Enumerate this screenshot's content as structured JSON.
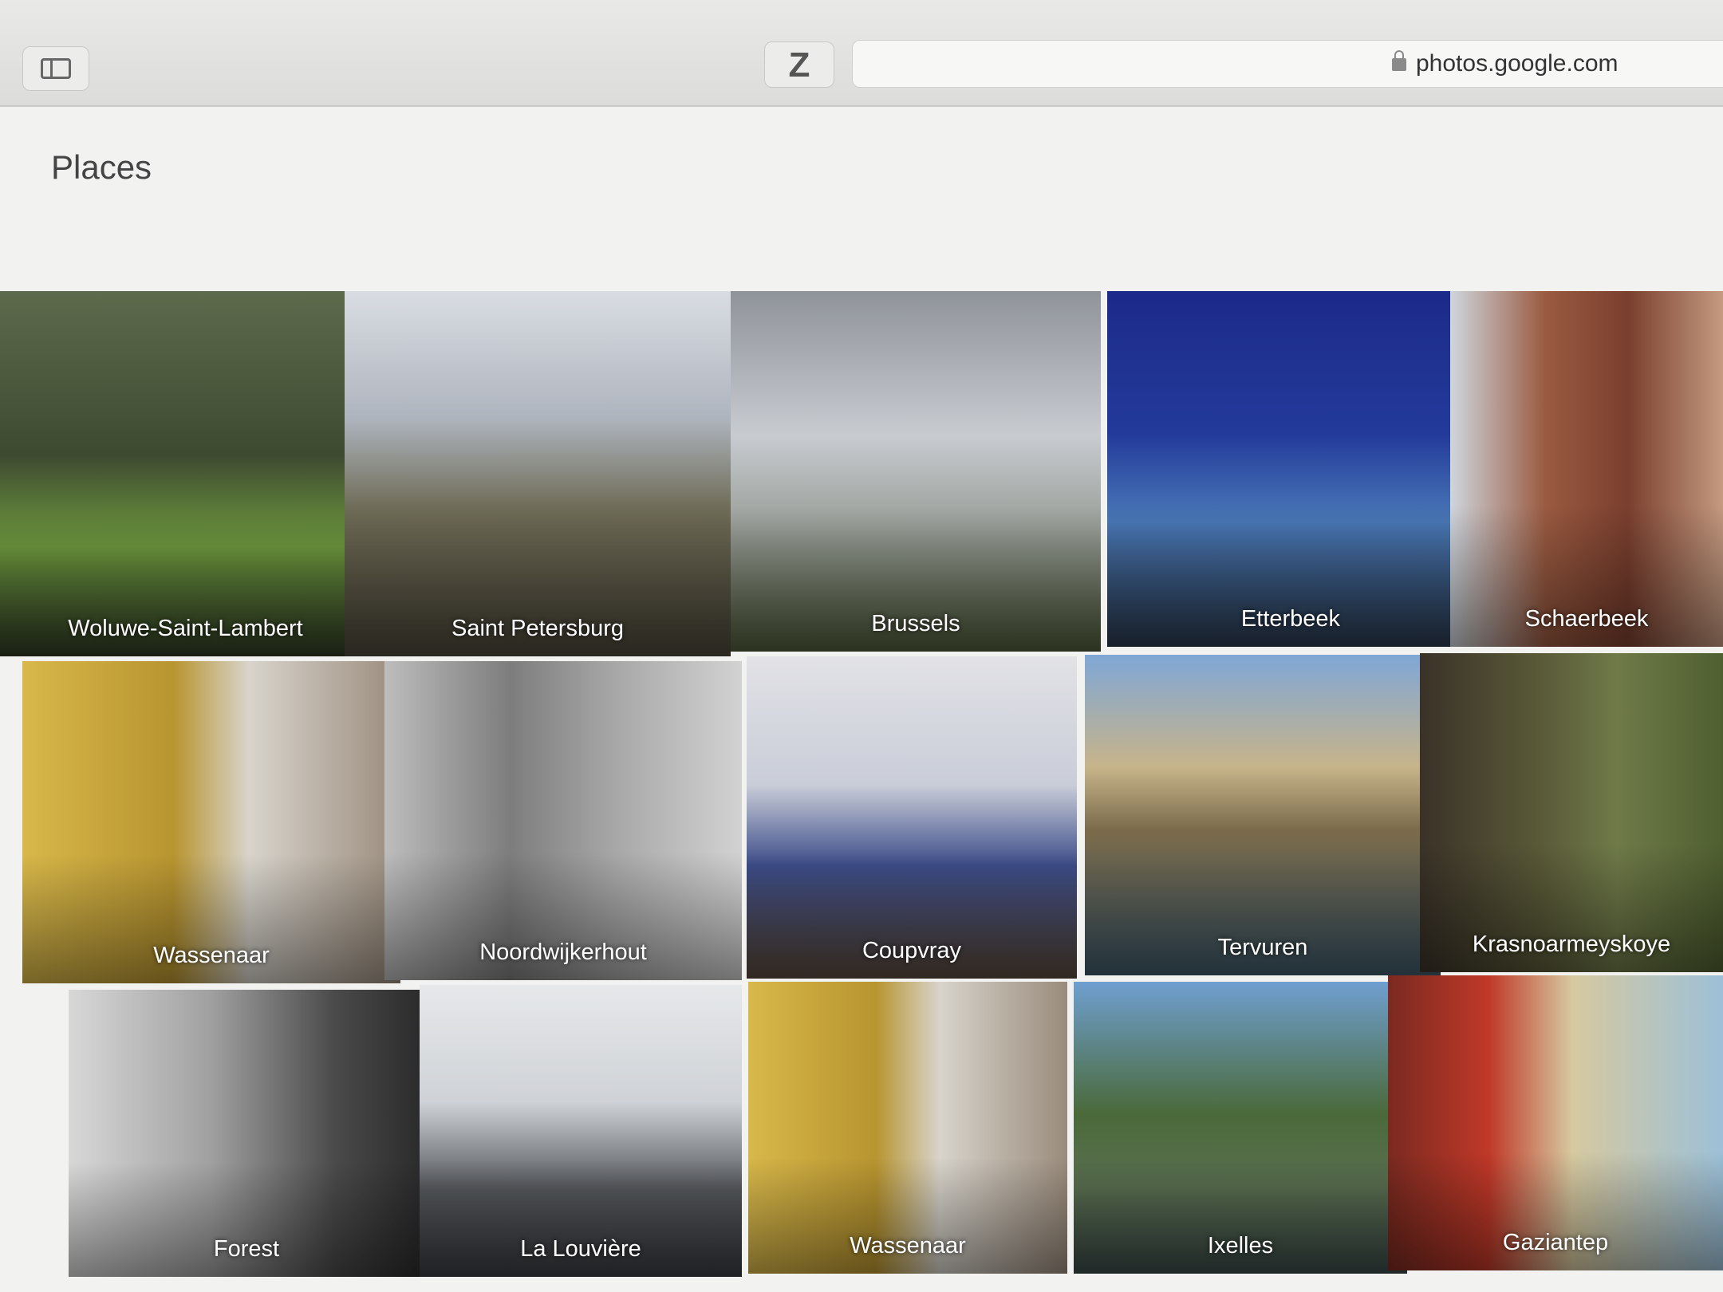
{
  "browser": {
    "url": "photos.google.com",
    "extension_label": "Z"
  },
  "page": {
    "title": "Places"
  },
  "places": [
    {
      "name": "Woluwe-Saint-Lambert",
      "bg": "linear-gradient(180deg,#5e6a4c 0%,#3e4a30 45%,#6f9b3f 70%,#2f3a24 100%)"
    },
    {
      "name": "Saint Petersburg",
      "bg": "linear-gradient(180deg,#d9dde3 0%,#aeb4bd 35%,#6d6a55 60%,#4a4638 100%)"
    },
    {
      "name": "Brussels",
      "bg": "linear-gradient(180deg,#8f939a 0%,#c8cbd0 40%,#9aa09a 65%,#4f5b3a 100%)"
    },
    {
      "name": "Etterbeek",
      "bg": "linear-gradient(180deg,#1c2a8a 0%,#233a9a 40%,#4a79b8 65%,#2b3a4d 100%)"
    },
    {
      "name": "Schaerbeek",
      "bg": "linear-gradient(90deg,#cfd6dd 0%,#9a5a40 35%,#7a3f2e 65%,#c49a80 100%)"
    },
    {
      "name": "Wassenaar",
      "bg": "linear-gradient(90deg,#d8b84a 0%,#b89530 40%,#d8d4cc 60%,#9a8c7c 100%)"
    },
    {
      "name": "Noordwijkerhout",
      "bg": "linear-gradient(90deg,#bdbdbd 0%,#7d7d7d 35%,#a8a8a8 65%,#d2d2d2 100%)"
    },
    {
      "name": "Coupvray",
      "bg": "linear-gradient(180deg,#e2e2e6 0%,#c9cdd8 40%,#3d4d8a 65%,#5a4a3a 100%)"
    },
    {
      "name": "Tervuren",
      "bg": "linear-gradient(180deg,#7fa7d6 0%,#c7b48a 35%,#7a6a4a 55%,#3f5a6a 100%)"
    },
    {
      "name": "Krasnoarmeyskoye",
      "bg": "linear-gradient(90deg,#3a3228 0%,#5a5a38 40%,#6f7a48 65%,#4f5f30 100%)"
    },
    {
      "name": "Forest",
      "bg": "linear-gradient(90deg,#d8d8d8 0%,#a0a0a0 40%,#4a4a4a 75%,#2a2a2a 100%)"
    },
    {
      "name": "La Louvière",
      "bg": "linear-gradient(180deg,#e6e8ea 0%,#cfd2d6 40%,#55585c 70%,#3a3c40 100%)"
    },
    {
      "name": "Wassenaar",
      "bg": "linear-gradient(90deg,#d8b84a 0%,#b89530 40%,#d8d4cc 60%,#9a8c7c 100%)"
    },
    {
      "name": "Ixelles",
      "bg": "linear-gradient(180deg,#6f9fd0 0%,#4a6a3a 45%,#5a6f50 70%,#3a4a48 100%)"
    },
    {
      "name": "Gaziantep",
      "bg": "linear-gradient(90deg,#7a2a20 0%,#c03828 30%,#d6c9a0 55%,#9cc0d8 100%)"
    }
  ]
}
